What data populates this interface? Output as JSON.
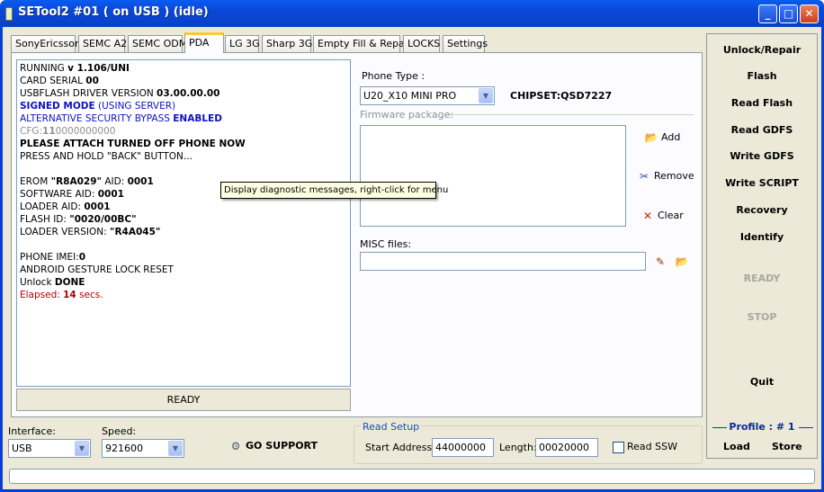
{
  "window": {
    "title": "SETool2 #01 ( on USB ) (idle)",
    "minimize": "_",
    "maximize": "□",
    "close": "✕"
  },
  "tabs": [
    {
      "label": "SonyEricsson"
    },
    {
      "label": "SEMC A2"
    },
    {
      "label": "SEMC ODM"
    },
    {
      "label": "PDA"
    },
    {
      "label": "LG 3G"
    },
    {
      "label": "Sharp 3G"
    },
    {
      "label": "Empty Fill & Repair"
    },
    {
      "label": "LOCKS"
    },
    {
      "label": "Settings"
    }
  ],
  "log": {
    "l1a": "RUNNING ",
    "l1b": "v 1.106/UNI",
    "l2a": "CARD SERIAL ",
    "l2b": "00",
    "l3a": "USBFLASH DRIVER VERSION ",
    "l3b": "03.00.00.00",
    "l4a": "SIGNED MODE",
    "l4b": " (USING SERVER)",
    "l5a": "ALTERNATIVE SECURITY BYPASS ",
    "l5b": "ENABLED",
    "l6a": "CFG:",
    "l6b": "11",
    "l6c": "0000000000",
    "l7": "PLEASE ATTACH TURNED OFF PHONE NOW",
    "l8": "PRESS AND HOLD \"BACK\" BUTTON...",
    "l10a": "EROM ",
    "l10b": "\"R8A029\"",
    "l10c": " AID: ",
    "l10d": "0001",
    "l11a": "SOFTWARE AID: ",
    "l11b": "0001",
    "l12a": "LOADER AID: ",
    "l12b": "0001",
    "l13a": "FLASH ID: ",
    "l13b": "\"0020/00BC\"",
    "l14a": "LOADER VERSION: ",
    "l14b": "\"R4A045\"",
    "l16a": "PHONE IMEI:",
    "l16b": "0",
    "l17": "ANDROID GESTURE LOCK RESET",
    "l18a": "Unlock ",
    "l18b": "DONE",
    "l19a": "Elapsed: ",
    "l19b": "14",
    "l19c": " secs."
  },
  "log_status": "READY",
  "tooltip": "Display diagnostic messages, right-click for menu",
  "pda": {
    "phone_type_label": "Phone Type :",
    "phone_type_value": "U20_X10 MINI PRO",
    "chipset": "CHIPSET:QSD7227",
    "firmware_label": "Firmware package:",
    "add": "Add",
    "remove": "Remove",
    "clear": "Clear",
    "misc_label": "MISC files:"
  },
  "side": {
    "unlock": "Unlock/Repair",
    "flash": "Flash",
    "read_flash": "Read Flash",
    "read_gdfs": "Read GDFS",
    "write_gdfs": "Write GDFS",
    "write_script": "Write SCRIPT",
    "recovery": "Recovery",
    "identify": "Identify",
    "ready": "READY",
    "stop": "STOP",
    "quit": "Quit",
    "profile_label": "Profile : ",
    "profile_value": "# 1",
    "load": "Load",
    "store": "Store"
  },
  "bottom": {
    "interface_label": "Interface:",
    "interface_value": "USB",
    "speed_label": "Speed:",
    "speed_value": "921600",
    "go_support": "GO SUPPORT",
    "read_setup": "Read Setup",
    "start_label": "Start Address:",
    "start_value": "44000000",
    "length_label": "Length:",
    "length_value": "00020000",
    "read_ssw": "Read SSW"
  },
  "colors": {
    "accent": "#0a47d8",
    "blue_text": "#1010c8",
    "red_text": "#b00000"
  },
  "icons": [
    "folder-open-icon",
    "scissors-icon",
    "red-x-icon",
    "pencil-icon",
    "support-icon"
  ]
}
